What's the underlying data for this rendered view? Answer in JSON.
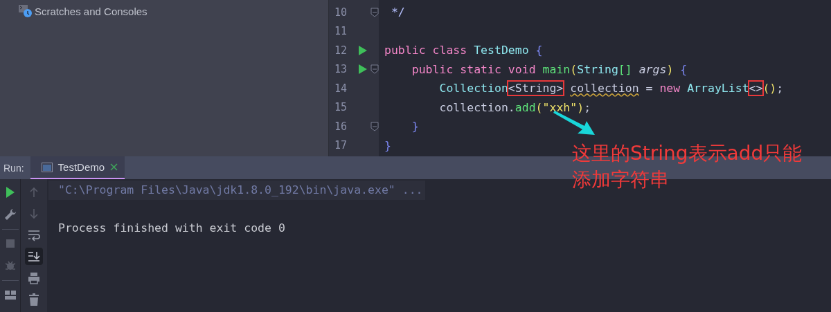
{
  "project_panel": {
    "items": [
      {
        "label": "Scratches and Consoles"
      }
    ]
  },
  "editor": {
    "lines": [
      {
        "number": "10",
        "run": false,
        "fold": true,
        "tokens": [
          {
            "text": " */",
            "kind": "comment"
          }
        ]
      },
      {
        "number": "11",
        "run": false,
        "fold": false
      },
      {
        "number": "12",
        "run": true,
        "fold": false,
        "tokens": [
          {
            "text": "public",
            "kind": "keyword"
          },
          {
            "text": " class",
            "kind": "keyword"
          },
          {
            "text": " TestDemo",
            "kind": "type"
          },
          {
            "text": " {",
            "kind": "brace"
          }
        ]
      },
      {
        "number": "13",
        "run": true,
        "fold": true,
        "tokens": [
          {
            "text": "    public",
            "kind": "keyword"
          },
          {
            "text": " static",
            "kind": "keyword"
          },
          {
            "text": " void",
            "kind": "keyword"
          },
          {
            "text": " main",
            "kind": "method"
          },
          {
            "text": "(",
            "kind": "paren"
          },
          {
            "text": "String",
            "kind": "type"
          },
          {
            "text": "[]",
            "kind": "bracket"
          },
          {
            "text": " args",
            "kind": "param"
          },
          {
            "text": ")",
            "kind": "paren"
          },
          {
            "text": " {",
            "kind": "brace"
          }
        ]
      },
      {
        "number": "14",
        "run": false,
        "fold": false,
        "tokens": [
          {
            "text": "        Collection",
            "kind": "type"
          },
          {
            "text": "<String>",
            "kind": "plain",
            "boxed": true
          },
          {
            "text": " collection",
            "kind": "plain",
            "warning": true
          },
          {
            "text": " =",
            "kind": "plain"
          },
          {
            "text": " new",
            "kind": "keyword"
          },
          {
            "text": " ArrayList",
            "kind": "type"
          },
          {
            "text": "<>",
            "kind": "plain",
            "boxed": true
          },
          {
            "text": "()",
            "kind": "paren"
          },
          {
            "text": ";",
            "kind": "plain"
          }
        ]
      },
      {
        "number": "15",
        "run": false,
        "fold": false,
        "tokens": [
          {
            "text": "        collection.",
            "kind": "plain"
          },
          {
            "text": "add",
            "kind": "method"
          },
          {
            "text": "(",
            "kind": "paren"
          },
          {
            "text": "\"xxh\"",
            "kind": "string"
          },
          {
            "text": ")",
            "kind": "paren"
          },
          {
            "text": ";",
            "kind": "plain"
          }
        ]
      },
      {
        "number": "16",
        "run": false,
        "fold": true,
        "tokens": [
          {
            "text": "    }",
            "kind": "brace"
          }
        ]
      },
      {
        "number": "17",
        "run": false,
        "fold": false,
        "tokens": [
          {
            "text": "}",
            "kind": "brace"
          }
        ]
      }
    ]
  },
  "annotation": {
    "lines": [
      "这里的String表示add只能",
      "添加字符串"
    ]
  },
  "run_panel": {
    "label": "Run:",
    "tabs": [
      {
        "label": "TestDemo",
        "selected": true
      }
    ],
    "left_toolbar": [
      {
        "kind": "run",
        "disabled": false
      },
      {
        "kind": "wrench",
        "disabled": false
      },
      {
        "kind": "separator"
      },
      {
        "kind": "stop",
        "disabled": true
      },
      {
        "kind": "debug",
        "disabled": true
      },
      {
        "kind": "separator"
      },
      {
        "kind": "layout",
        "disabled": false
      }
    ],
    "right_toolbar": [
      {
        "kind": "up",
        "disabled": true,
        "selected": false
      },
      {
        "kind": "down",
        "disabled": true,
        "selected": false
      },
      {
        "kind": "wrap",
        "disabled": false,
        "selected": false
      },
      {
        "kind": "scroll-end",
        "disabled": false,
        "selected": true
      },
      {
        "kind": "print",
        "disabled": false,
        "selected": false
      },
      {
        "kind": "trash",
        "disabled": false,
        "selected": false
      }
    ],
    "console": [
      {
        "text": "\"C:\\Program Files\\Java\\jdk1.8.0_192\\bin\\java.exe\" ...",
        "kind": "command"
      },
      {
        "text": "Process finished with exit code 0",
        "kind": "output"
      }
    ]
  }
}
